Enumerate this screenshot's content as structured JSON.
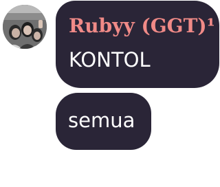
{
  "conversation": {
    "avatar": {
      "icon": "group-photo-avatar"
    },
    "messages": [
      {
        "sender": "Rubyy (GGT)¹",
        "sender_color": "#f08a87",
        "text": "KONTOL"
      },
      {
        "text": "semua"
      }
    ],
    "colors": {
      "bubble_background": "#2a2537",
      "message_text": "#ffffff"
    }
  }
}
